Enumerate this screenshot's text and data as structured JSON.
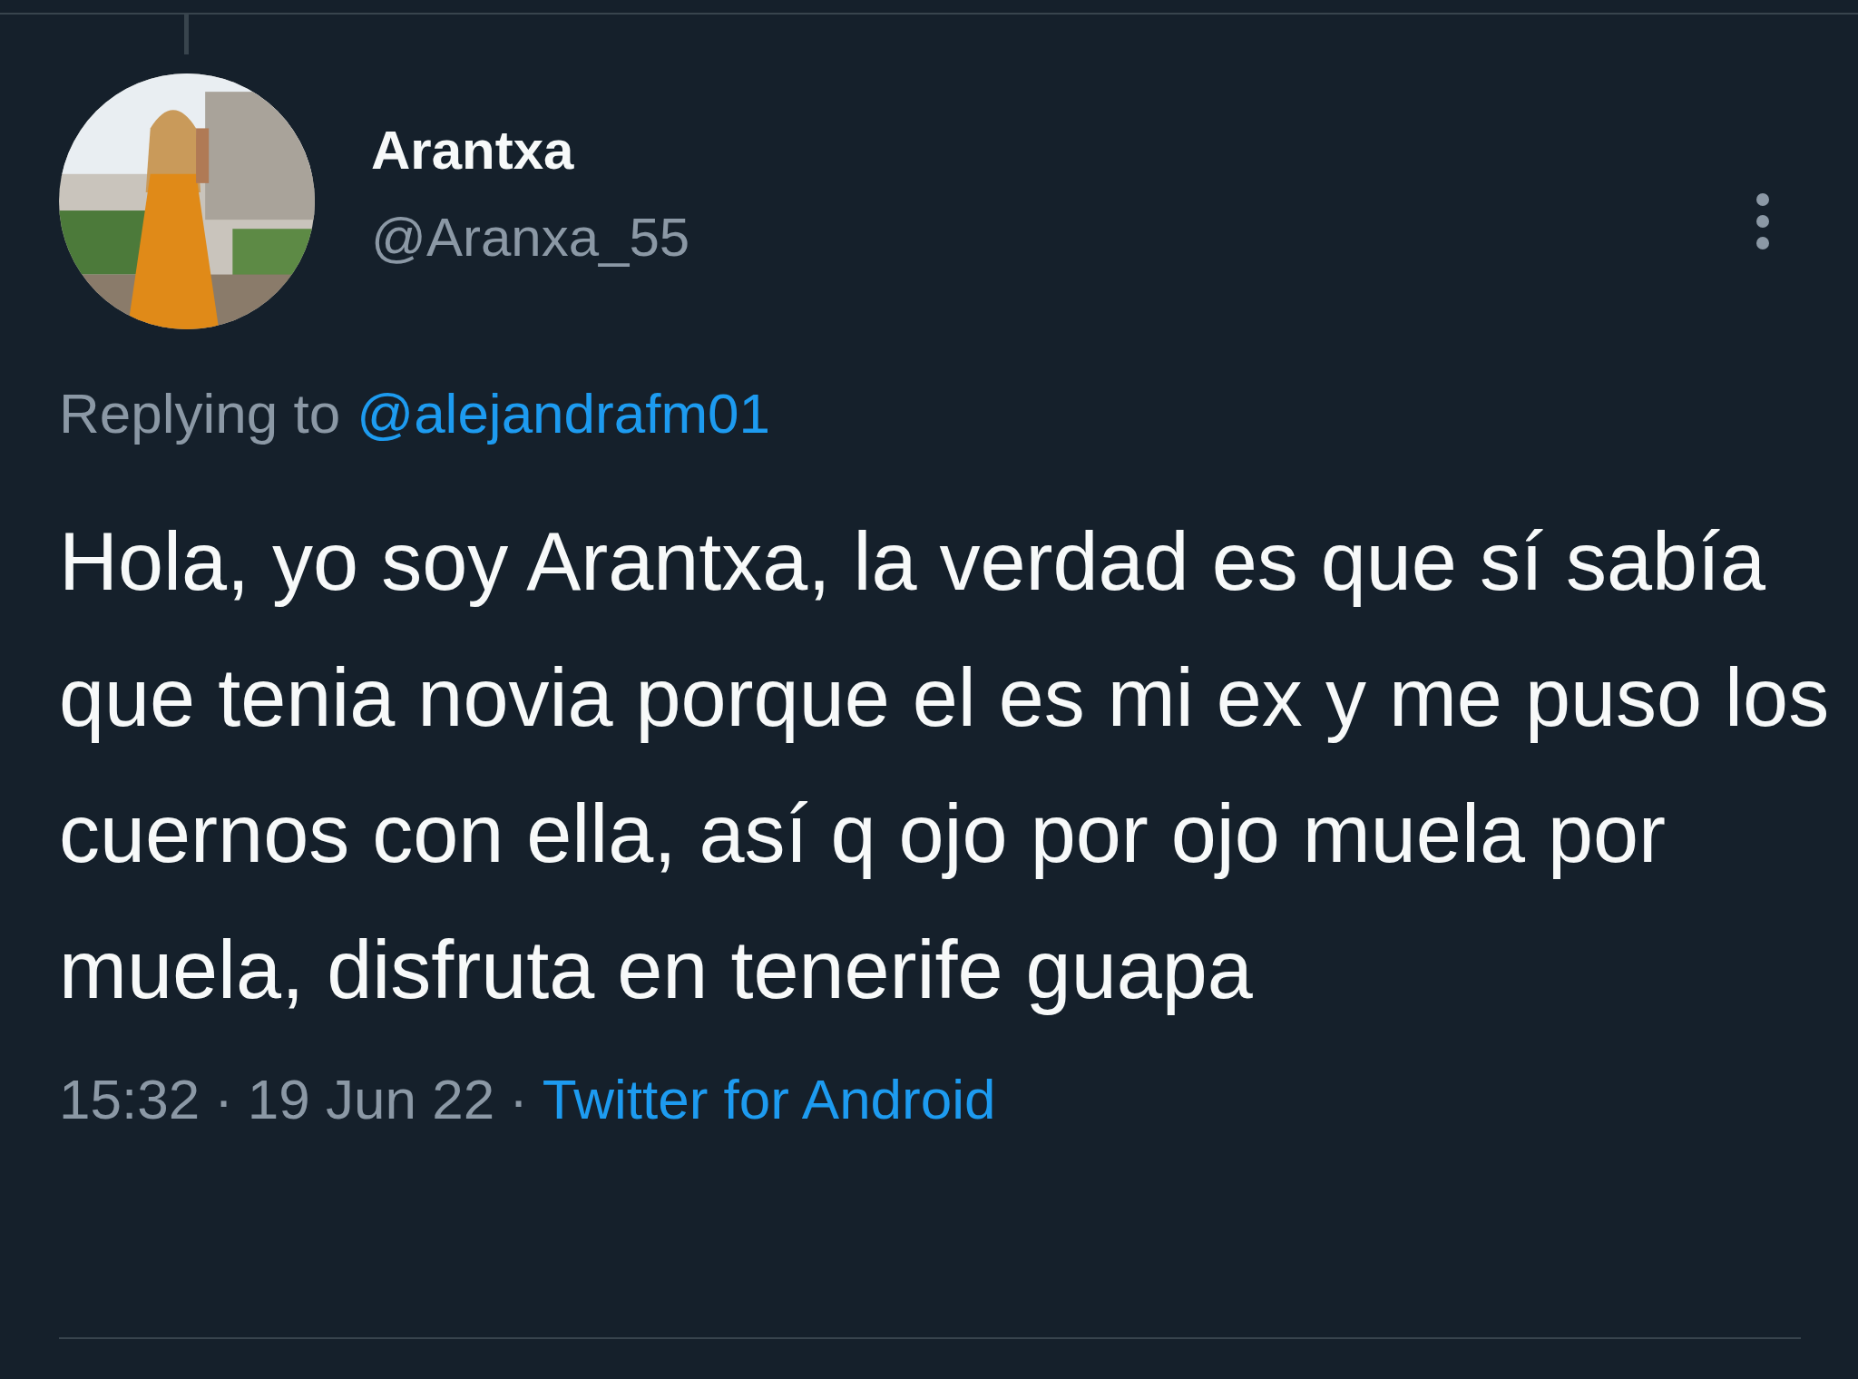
{
  "tweet": {
    "author": {
      "name": "Arantxa",
      "handle": "@Aranxa_55"
    },
    "reply_to": {
      "label": "Replying to",
      "handle": "@alejandrafm01"
    },
    "text": "Hola, yo soy Arantxa, la verdad es que sí sabía que tenia novia porque el es mi ex y me puso los cuernos con ella, así q ojo por ojo muela por muela, disfruta en tenerife guapa",
    "meta": {
      "time": "15:32",
      "sep_1": "·",
      "date": "19 Jun 22",
      "sep_2": "·",
      "source": "Twitter for Android"
    }
  }
}
